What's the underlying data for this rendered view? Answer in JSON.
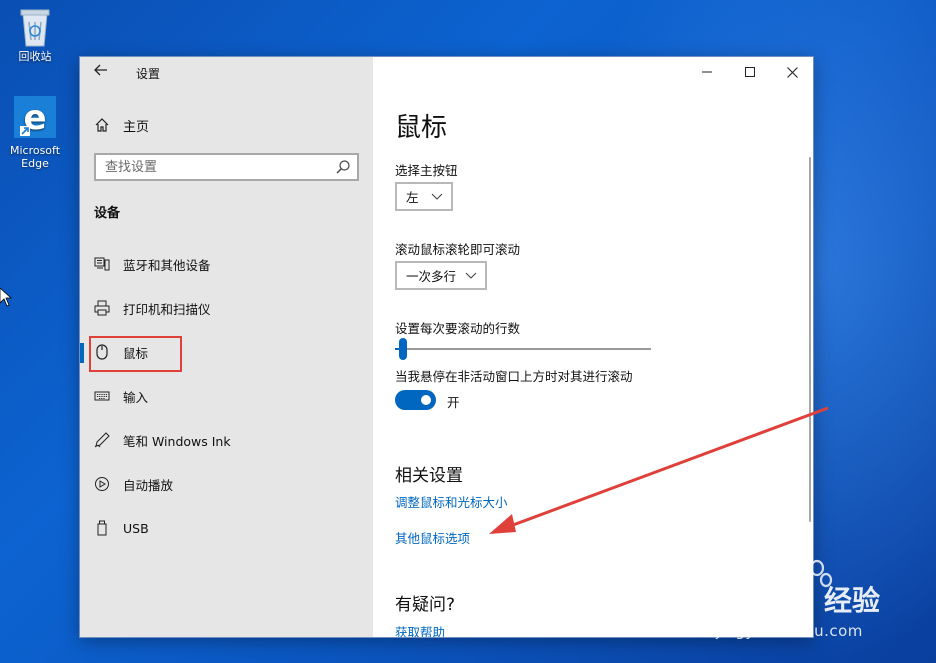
{
  "desktop": {
    "icons": [
      {
        "label": "回收站",
        "icon": "recycle-bin-icon"
      },
      {
        "label": "Microsoft Edge",
        "icon": "edge-icon"
      }
    ]
  },
  "window": {
    "title": "设置",
    "controls": [
      "minimize-icon",
      "maximize-icon",
      "close-icon"
    ]
  },
  "sidebar": {
    "home_label": "主页",
    "search_placeholder": "查找设置",
    "section_title": "设备",
    "items": [
      {
        "label": "蓝牙和其他设备",
        "icon": "bluetooth-devices-icon"
      },
      {
        "label": "打印机和扫描仪",
        "icon": "printer-icon"
      },
      {
        "label": "鼠标",
        "icon": "mouse-icon",
        "active": true
      },
      {
        "label": "输入",
        "icon": "keyboard-icon"
      },
      {
        "label": "笔和 Windows Ink",
        "icon": "pen-icon"
      },
      {
        "label": "自动播放",
        "icon": "autoplay-icon"
      },
      {
        "label": "USB",
        "icon": "usb-icon"
      }
    ]
  },
  "content": {
    "page_title": "鼠标",
    "primary_button_label": "选择主按钮",
    "primary_button_value": "左",
    "scroll_label": "滚动鼠标滚轮即可滚动",
    "scroll_value": "一次多行",
    "lines_label": "设置每次要滚动的行数",
    "lines_slider_fraction": 0.03,
    "inactive_scroll_label": "当我悬停在非活动窗口上方时对其进行滚动",
    "toggle_state": "开",
    "related_title": "相关设置",
    "related_links": [
      "调整鼠标和光标大小",
      "其他鼠标选项"
    ],
    "question_title": "有疑问?",
    "help_link": "获取帮助"
  },
  "watermark": {
    "brand": "Baidu",
    "suffix": "经验",
    "url": "jingyan.baidu.com"
  },
  "colors": {
    "accent": "#0067c0",
    "annotation_red": "#e0403a",
    "sidebar_bg": "#e6e6e6"
  }
}
